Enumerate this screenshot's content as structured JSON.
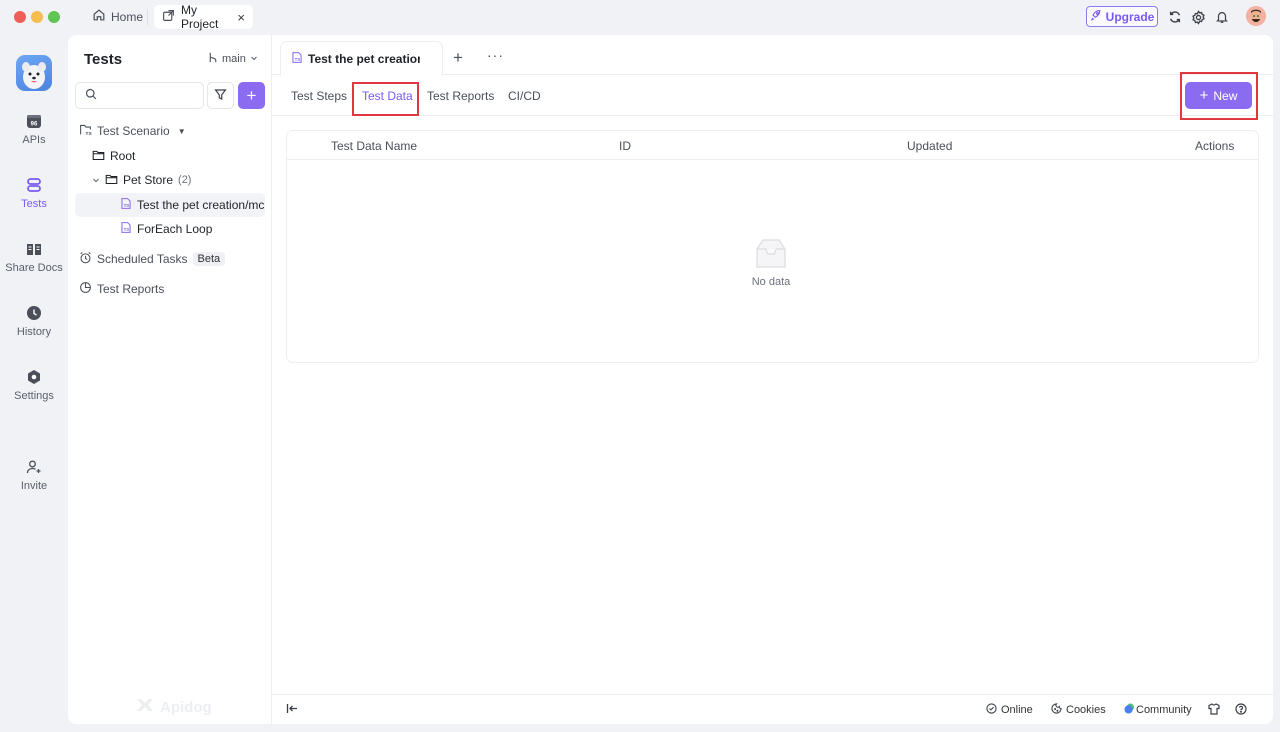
{
  "window": {
    "tabs": [
      {
        "label": "Home",
        "icon": "home-icon"
      },
      {
        "label": "My Project",
        "icon": "external-link-icon",
        "active": true,
        "closable": true
      }
    ],
    "upgrade_label": "Upgrade",
    "right_icons": [
      "refresh-icon",
      "gear-icon",
      "bell-icon",
      "avatar"
    ]
  },
  "rail": {
    "items": [
      {
        "label": "APIs",
        "icon": "api-icon"
      },
      {
        "label": "Tests",
        "icon": "tests-icon",
        "active": true
      },
      {
        "label": "Share Docs",
        "icon": "book-icon"
      },
      {
        "label": "History",
        "icon": "clock-icon"
      },
      {
        "label": "Settings",
        "icon": "settings-icon"
      },
      {
        "label": "Invite",
        "icon": "add-user-icon"
      }
    ]
  },
  "tree": {
    "title": "Tests",
    "branch": "main",
    "search_placeholder": "",
    "items": [
      {
        "label": "Test Scenario",
        "icon": "test-scenario-icon",
        "caret": "▼"
      },
      {
        "label": "Root",
        "icon": "folder-icon"
      },
      {
        "label": "Pet Store",
        "icon": "folder-icon",
        "count": "(2)",
        "expanded": true
      },
      {
        "label": "Test the pet creation/mc",
        "icon": "test-file-icon",
        "selected": true
      },
      {
        "label": "ForEach Loop",
        "icon": "test-file-icon"
      },
      {
        "label": "Scheduled Tasks",
        "icon": "alarm-icon",
        "badge": "Beta"
      },
      {
        "label": "Test Reports",
        "icon": "pie-chart-icon"
      }
    ],
    "watermark": "Apidog"
  },
  "main": {
    "doc_tab_label": "Test the pet creation/",
    "subtabs": [
      {
        "label": "Test Steps"
      },
      {
        "label": "Test Data",
        "active": true
      },
      {
        "label": "Test Reports"
      },
      {
        "label": "CI/CD"
      }
    ],
    "new_button_label": "New",
    "table": {
      "columns": [
        "Test Data Name",
        "ID",
        "Updated",
        "Actions"
      ],
      "rows": [],
      "empty_text": "No data"
    }
  },
  "footer": {
    "items": [
      {
        "label": "Online",
        "icon": "check-circle-icon"
      },
      {
        "label": "Cookies",
        "icon": "cookie-icon"
      },
      {
        "label": "Community",
        "icon": "chat-bubble-icon"
      }
    ],
    "icons": [
      "shirt-icon",
      "help-icon"
    ]
  },
  "colors": {
    "accent": "#8b6cf0",
    "accent_text": "#7a5af8",
    "highlight_box": "#e0383e",
    "background": "#f1f2f6"
  }
}
